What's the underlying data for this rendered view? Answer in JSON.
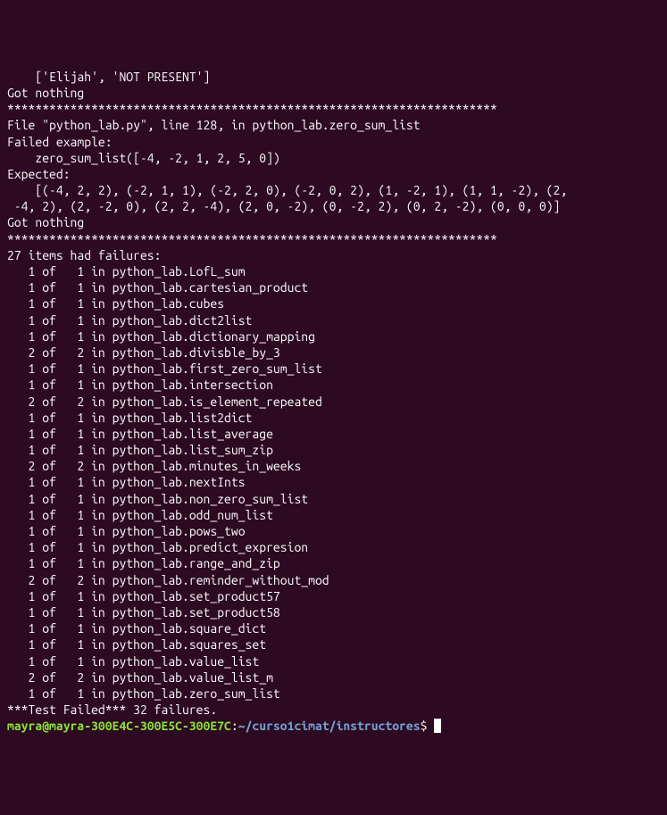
{
  "output": {
    "line1": "    ['Elijah', 'NOT PRESENT']",
    "line2": "Got nothing",
    "line3": "**********************************************************************",
    "line4": "File \"python_lab.py\", line 128, in python_lab.zero_sum_list",
    "line5": "Failed example:",
    "line6": "    zero_sum_list([-4, -2, 1, 2, 5, 0])",
    "line7": "Expected:",
    "line8": "    [(-4, 2, 2), (-2, 1, 1), (-2, 2, 0), (-2, 0, 2), (1, -2, 1), (1, 1, -2), (2,",
    "line9": " -4, 2), (2, -2, 0), (2, 2, -4), (2, 0, -2), (0, -2, 2), (0, 2, -2), (0, 0, 0)]",
    "line10": "Got nothing",
    "line11": "**********************************************************************",
    "line12": "27 items had failures:",
    "failures": [
      "   1 of   1 in python_lab.LofL_sum",
      "   1 of   1 in python_lab.cartesian_product",
      "   1 of   1 in python_lab.cubes",
      "   1 of   1 in python_lab.dict2list",
      "   1 of   1 in python_lab.dictionary_mapping",
      "   2 of   2 in python_lab.divisble_by_3",
      "   1 of   1 in python_lab.first_zero_sum_list",
      "   1 of   1 in python_lab.intersection",
      "   2 of   2 in python_lab.is_element_repeated",
      "   1 of   1 in python_lab.list2dict",
      "   1 of   1 in python_lab.list_average",
      "   1 of   1 in python_lab.list_sum_zip",
      "   2 of   2 in python_lab.minutes_in_weeks",
      "   1 of   1 in python_lab.nextInts",
      "   1 of   1 in python_lab.non_zero_sum_list",
      "   1 of   1 in python_lab.odd_num_list",
      "   1 of   1 in python_lab.pows_two",
      "   1 of   1 in python_lab.predict_expresion",
      "   1 of   1 in python_lab.range_and_zip",
      "   2 of   2 in python_lab.reminder_without_mod",
      "   1 of   1 in python_lab.set_product57",
      "   1 of   1 in python_lab.set_product58",
      "   1 of   1 in python_lab.square_dict",
      "   1 of   1 in python_lab.squares_set",
      "   1 of   1 in python_lab.value_list",
      "   2 of   2 in python_lab.value_list_m",
      "   1 of   1 in python_lab.zero_sum_list"
    ],
    "testFailed": "***Test Failed*** 32 failures."
  },
  "prompt": {
    "user": "mayra@mayra-300E4C-300E5C-300E7C",
    "separator": ":",
    "path": "~/curso1cimat/instructores",
    "end": "$ "
  }
}
